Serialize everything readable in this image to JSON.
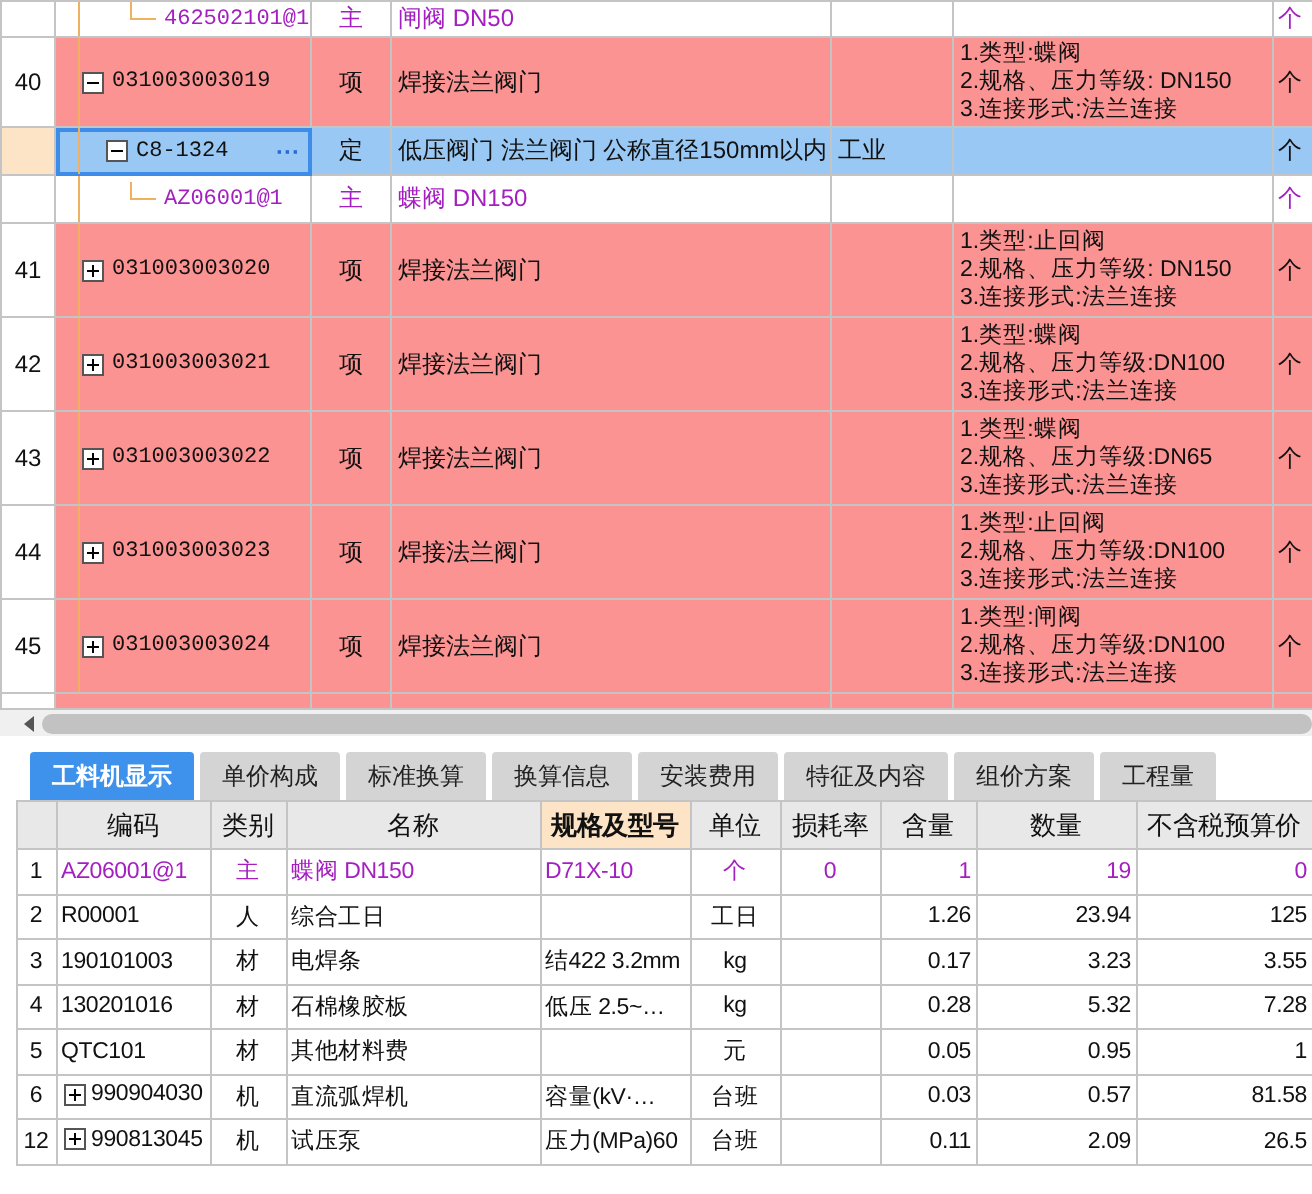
{
  "grid": {
    "rows": [
      {
        "kind": "sub",
        "num": "",
        "code": "462502101@1",
        "type": "主",
        "name": "闸阀 DN50",
        "extra": "",
        "features": [],
        "unit": "个",
        "selected": false
      },
      {
        "kind": "item",
        "num": "40",
        "code": "031003003019",
        "type": "项",
        "name": "焊接法兰阀门",
        "extra": "",
        "features": [
          "1.类型:蝶阀",
          "2.规格、压力等级: DN150",
          "3.连接形式:法兰连接"
        ],
        "unit": "个",
        "selected": false,
        "expanded": true
      },
      {
        "kind": "quota",
        "num": "",
        "code": "C8-1324",
        "more": "···",
        "type": "定",
        "name": "低压阀门 法兰阀门 公称直径150mm以内",
        "extra": "工业",
        "features": [],
        "unit": "个",
        "selected": true,
        "expanded": true
      },
      {
        "kind": "sub",
        "num": "",
        "code": "AZ06001@1",
        "type": "主",
        "name": "蝶阀 DN150",
        "extra": "",
        "features": [],
        "unit": "个",
        "selected": false
      },
      {
        "kind": "item",
        "num": "41",
        "code": "031003003020",
        "type": "项",
        "name": "焊接法兰阀门",
        "extra": "",
        "features": [
          "1.类型:止回阀",
          "2.规格、压力等级: DN150",
          "3.连接形式:法兰连接"
        ],
        "unit": "个",
        "selected": false,
        "expanded": false
      },
      {
        "kind": "item",
        "num": "42",
        "code": "031003003021",
        "type": "项",
        "name": "焊接法兰阀门",
        "extra": "",
        "features": [
          "1.类型:蝶阀",
          "2.规格、压力等级:DN100",
          "3.连接形式:法兰连接"
        ],
        "unit": "个",
        "selected": false,
        "expanded": false
      },
      {
        "kind": "item",
        "num": "43",
        "code": "031003003022",
        "type": "项",
        "name": "焊接法兰阀门",
        "extra": "",
        "features": [
          "1.类型:蝶阀",
          "2.规格、压力等级:DN65",
          "3.连接形式:法兰连接"
        ],
        "unit": "个",
        "selected": false,
        "expanded": false
      },
      {
        "kind": "item",
        "num": "44",
        "code": "031003003023",
        "type": "项",
        "name": "焊接法兰阀门",
        "extra": "",
        "features": [
          "1.类型:止回阀",
          "2.规格、压力等级:DN100",
          "3.连接形式:法兰连接"
        ],
        "unit": "个",
        "selected": false,
        "expanded": false
      },
      {
        "kind": "item",
        "num": "45",
        "code": "031003003024",
        "type": "项",
        "name": "焊接法兰阀门",
        "extra": "",
        "features": [
          "1.类型:闸阀",
          "2.规格、压力等级:DN100",
          "3.连接形式:法兰连接"
        ],
        "unit": "个",
        "selected": false,
        "expanded": false
      }
    ]
  },
  "tabs": [
    {
      "label": "工料机显示",
      "selected": true
    },
    {
      "label": "单价构成",
      "selected": false
    },
    {
      "label": "标准换算",
      "selected": false
    },
    {
      "label": "换算信息",
      "selected": false
    },
    {
      "label": "安装费用",
      "selected": false
    },
    {
      "label": "特征及内容",
      "selected": false
    },
    {
      "label": "组价方案",
      "selected": false
    },
    {
      "label": "工程量",
      "selected": false
    }
  ],
  "resources": {
    "columns": [
      {
        "label": "编码",
        "selected": false
      },
      {
        "label": "类别",
        "selected": false
      },
      {
        "label": "名称",
        "selected": false
      },
      {
        "label": "规格及型号",
        "selected": true
      },
      {
        "label": "单位",
        "selected": false
      },
      {
        "label": "损耗率",
        "selected": false
      },
      {
        "label": "含量",
        "selected": false
      },
      {
        "label": "数量",
        "selected": false
      },
      {
        "label": "不含税预算价",
        "selected": false
      }
    ],
    "rows": [
      {
        "kind": "main",
        "num": "1",
        "expandable": false,
        "cells": [
          "AZ06001@1",
          "主",
          "蝶阀 DN150",
          "D71X-10",
          "个",
          "0",
          "1",
          "19",
          "0"
        ]
      },
      {
        "kind": "normal",
        "num": "2",
        "expandable": false,
        "cells": [
          "R00001",
          "人",
          "综合工日",
          "",
          "工日",
          "",
          "1.26",
          "23.94",
          "125"
        ]
      },
      {
        "kind": "normal",
        "num": "3",
        "expandable": false,
        "cells": [
          "190101003",
          "材",
          "电焊条",
          "结422 3.2mm",
          "kg",
          "",
          "0.17",
          "3.23",
          "3.55"
        ]
      },
      {
        "kind": "normal",
        "num": "4",
        "expandable": false,
        "cells": [
          "130201016",
          "材",
          "石棉橡胶板",
          "低压 2.5~…",
          "kg",
          "",
          "0.28",
          "5.32",
          "7.28"
        ]
      },
      {
        "kind": "normal",
        "num": "5",
        "expandable": false,
        "cells": [
          "QTC101",
          "材",
          "其他材料费",
          "",
          "元",
          "",
          "0.05",
          "0.95",
          "1"
        ]
      },
      {
        "kind": "normal",
        "num": "6",
        "expandable": true,
        "cells": [
          "990904030",
          "机",
          "直流弧焊机",
          "容量(kV·…",
          "台班",
          "",
          "0.03",
          "0.57",
          "81.58"
        ]
      },
      {
        "kind": "normal",
        "num": "12",
        "expandable": true,
        "cells": [
          "990813045",
          "机",
          "试压泵",
          "压力(MPa)60",
          "台班",
          "",
          "0.11",
          "2.09",
          "26.5"
        ]
      }
    ]
  }
}
